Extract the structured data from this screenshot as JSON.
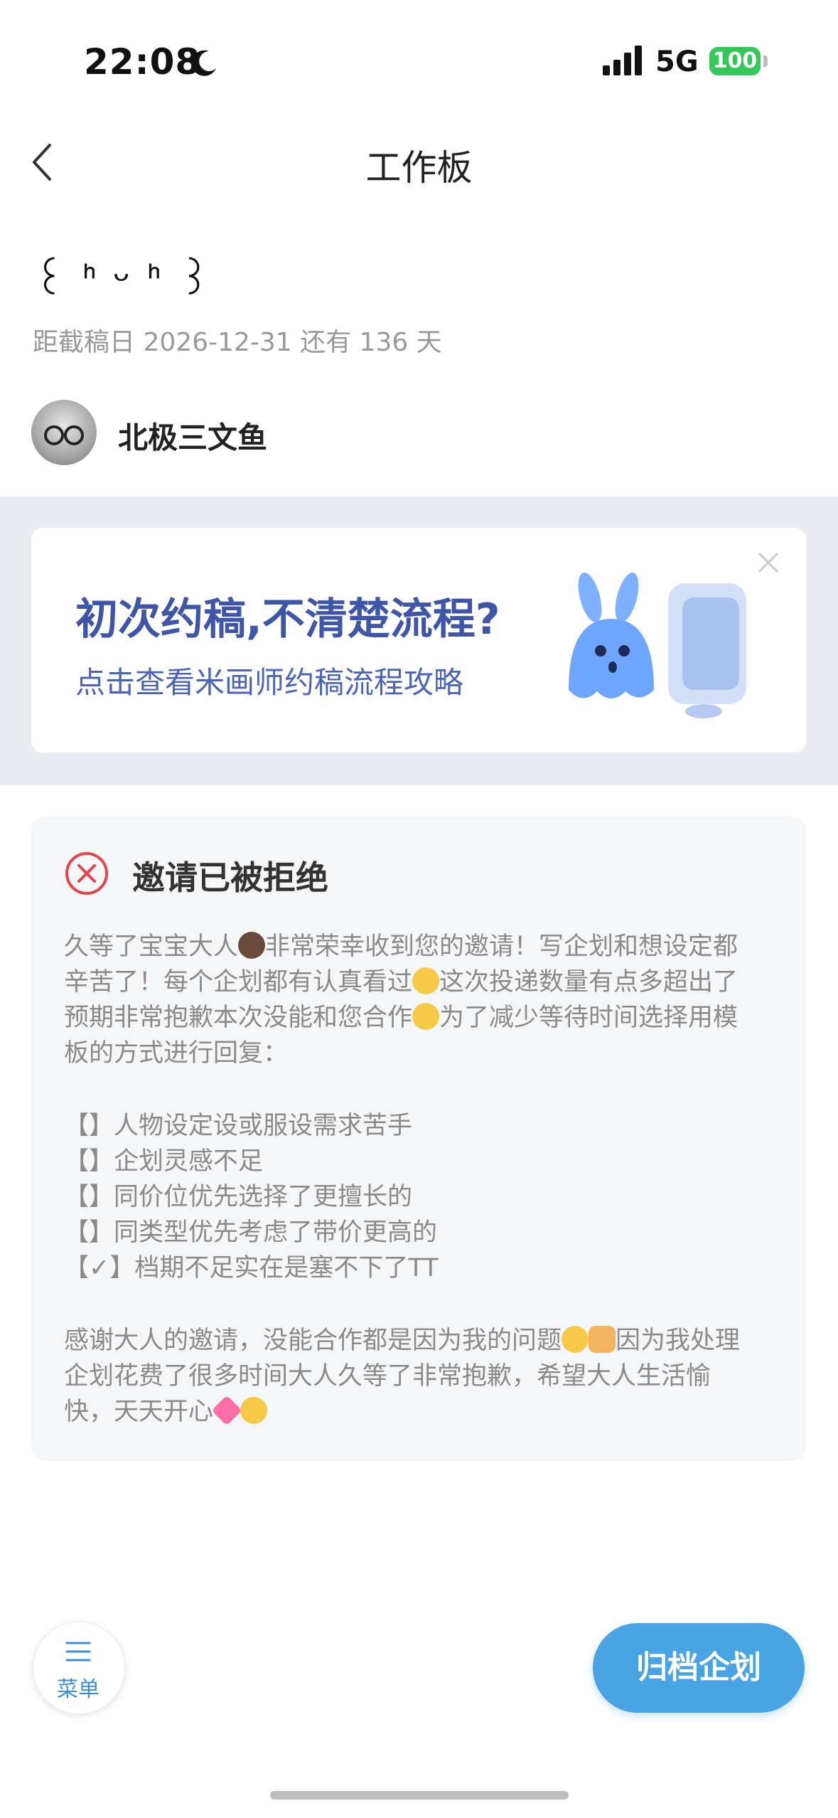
{
  "status_bar": {
    "time": "22:08",
    "network": "5G",
    "battery": "100"
  },
  "nav": {
    "title": "工作板"
  },
  "plan": {
    "title": "꒰ ᑋ ᵕ ᑋ ꒱",
    "deadline": "距截稿日 2026-12-31 还有 136 天",
    "author": "北极三文鱼"
  },
  "banner": {
    "title": "初次约稿,不清楚流程?",
    "subtitle": "点击查看米画师约稿流程攻略"
  },
  "card": {
    "title": "邀请已被拒绝",
    "lines": [
      "久等了宝宝大人",
      "非常荣幸收到您的邀请！写企划和想设定都",
      "辛苦了！每个企划都有认真看过",
      "这次投递数量有点多超出了",
      "预期非常抱歉本次没能和您合作",
      "为了减少等待时间选择用模",
      "板的方式进行回复：",
      "【】人物设定设或服设需求苦手",
      "【】企划灵感不足",
      "【】同价位优先选择了更擅长的",
      "【】同类型优先考虑了带价更高的",
      "【✓】档期不足实在是塞不下了TT",
      "感谢大人的邀请，没能合作都是因为我的问题",
      "因为我处理",
      "企划花费了很多时间大人久等了非常抱歉，希望大人生活愉",
      "快，天天开心"
    ]
  },
  "bottom": {
    "menu_label": "菜单",
    "archive_label": "归档企划"
  },
  "colors": {
    "accent": "#4aa3e2",
    "banner_title": "#3f55a8",
    "reject_red": "#e0474c"
  }
}
